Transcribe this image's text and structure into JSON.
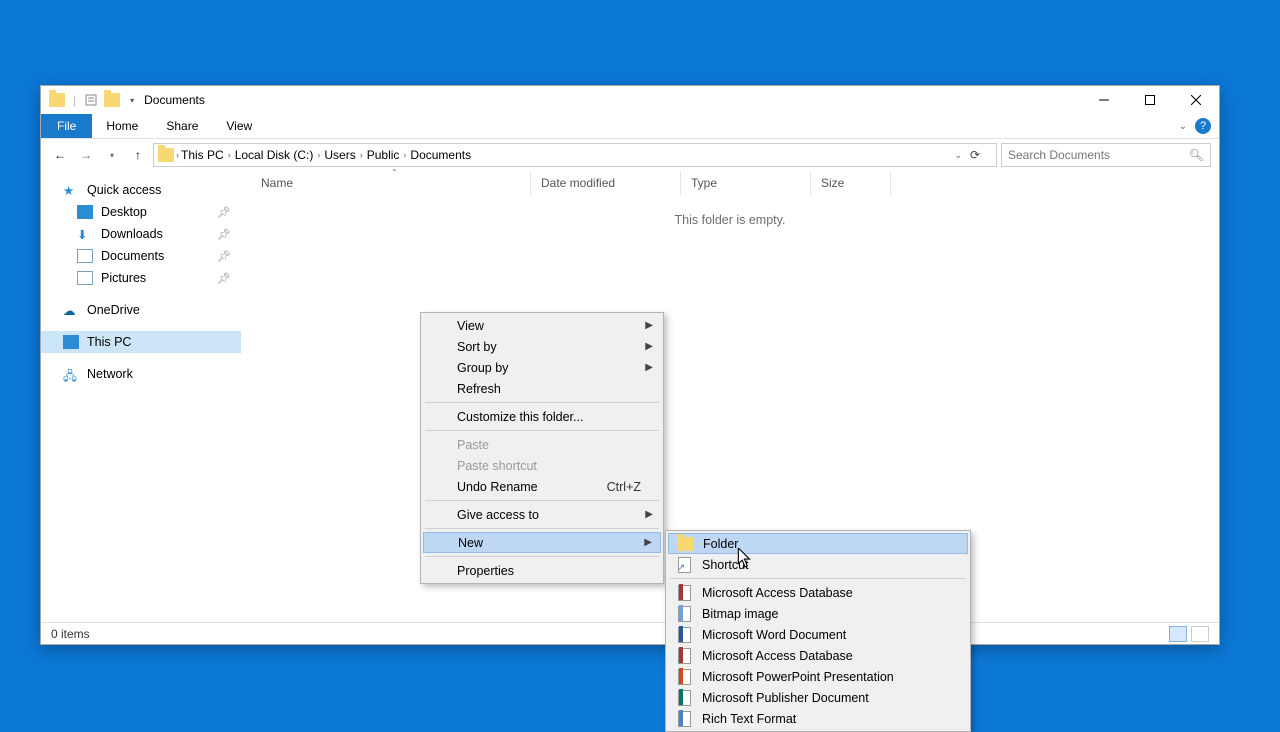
{
  "window": {
    "title": "Documents"
  },
  "ribbon": {
    "file": "File",
    "tabs": [
      "Home",
      "Share",
      "View"
    ]
  },
  "breadcrumb": [
    "This PC",
    "Local Disk (C:)",
    "Users",
    "Public",
    "Documents"
  ],
  "search": {
    "placeholder": "Search Documents"
  },
  "sidebar": {
    "quick_access": "Quick access",
    "items": [
      {
        "label": "Desktop",
        "pinned": true
      },
      {
        "label": "Downloads",
        "pinned": true
      },
      {
        "label": "Documents",
        "pinned": true
      },
      {
        "label": "Pictures",
        "pinned": true
      }
    ],
    "onedrive": "OneDrive",
    "thispc": "This PC",
    "network": "Network"
  },
  "columns": {
    "name": "Name",
    "date": "Date modified",
    "type": "Type",
    "size": "Size"
  },
  "content": {
    "empty": "This folder is empty."
  },
  "status": {
    "items": "0 items"
  },
  "context_menu": {
    "view": "View",
    "sortby": "Sort by",
    "groupby": "Group by",
    "refresh": "Refresh",
    "customize": "Customize this folder...",
    "paste": "Paste",
    "paste_shortcut": "Paste shortcut",
    "undo": "Undo Rename",
    "undo_key": "Ctrl+Z",
    "give_access": "Give access to",
    "new": "New",
    "properties": "Properties"
  },
  "new_submenu": [
    {
      "label": "Folder",
      "color": "#f8d872",
      "kind": "folder"
    },
    {
      "label": "Shortcut",
      "color": "#4a82c4",
      "kind": "shortcut"
    },
    {
      "label": "Microsoft Access Database",
      "color": "#a4373a"
    },
    {
      "label": "Bitmap image",
      "color": "#6ea2d8"
    },
    {
      "label": "Microsoft Word Document",
      "color": "#2b579a"
    },
    {
      "label": "Microsoft Access Database",
      "color": "#a4373a"
    },
    {
      "label": "Microsoft PowerPoint Presentation",
      "color": "#d24726"
    },
    {
      "label": "Microsoft Publisher Document",
      "color": "#077568"
    },
    {
      "label": "Rich Text Format",
      "color": "#4a82c4"
    }
  ]
}
